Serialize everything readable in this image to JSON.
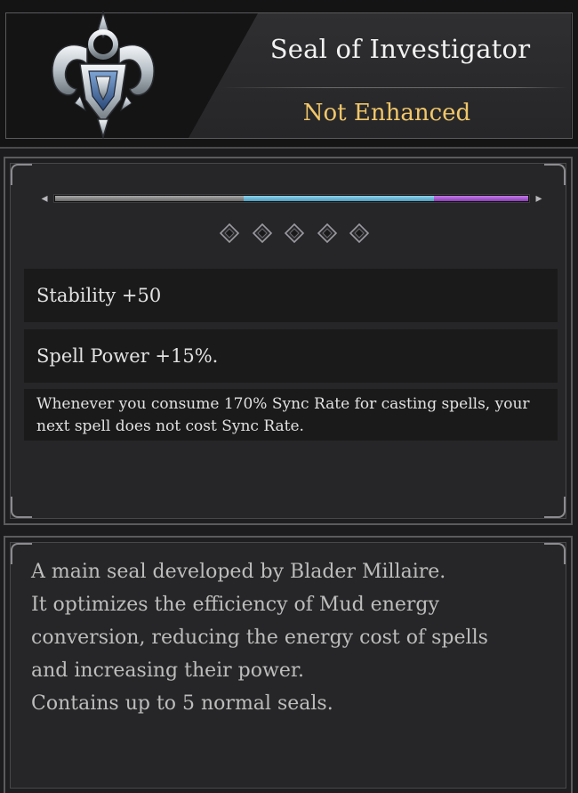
{
  "item": {
    "name": "Seal of Investigator",
    "enhance_status": "Not Enhanced",
    "emblem_icon": "horned-crest-icon"
  },
  "sync_bar": {
    "segments": [
      {
        "name": "grey",
        "color": "#8c8c8c"
      },
      {
        "name": "blue",
        "color": "#6fb8d8"
      },
      {
        "name": "purple",
        "color": "#a85ad0"
      }
    ]
  },
  "seal_slots": {
    "count": 5,
    "filled": 0,
    "icon": "diamond-slot-icon"
  },
  "stats": [
    {
      "text": "Stability +50"
    },
    {
      "text": "Spell Power +15%."
    },
    {
      "text": "Whenever you consume 170% Sync Rate for casting spells, your next spell does not cost Sync Rate."
    }
  ],
  "description": {
    "lines": [
      "A main seal developed by Blader Millaire.",
      "It optimizes the efficiency of Mud energy",
      "conversion, reducing the energy cost of spells",
      "and increasing their power.",
      "Contains up to 5 normal seals."
    ]
  },
  "colors": {
    "accent_gold": "#f1c76a",
    "title_white": "#f2f2f2"
  }
}
